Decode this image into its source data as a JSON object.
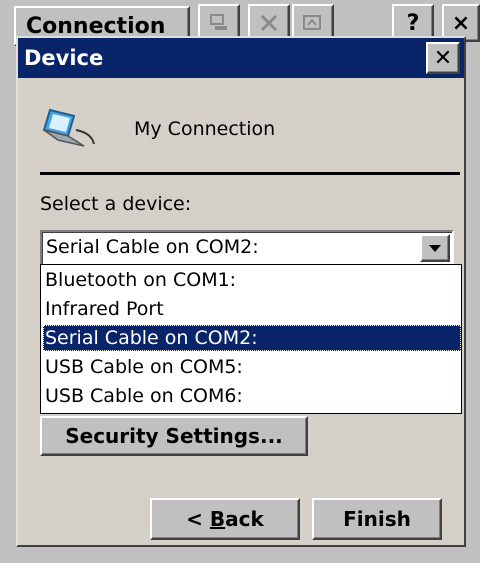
{
  "background_window": {
    "title": "Connection",
    "toolbar_icons": [
      "connect-icon",
      "delete-icon",
      "properties-icon"
    ],
    "help_label": "?",
    "close_label": "×"
  },
  "dialog": {
    "title": "Device",
    "close_label": "✕",
    "connection_icon": "network-connection-icon",
    "connection_name": "My Connection",
    "select_label": "Select a device:",
    "combo": {
      "selected_value": "Serial Cable on COM2:",
      "options": [
        "Bluetooth on COM1:",
        "Infrared Port",
        "Serial Cable on COM2:",
        "USB Cable on COM5:",
        "USB Cable on COM6:"
      ],
      "selected_index": 2
    },
    "security_button_label": "Security Settings...",
    "back_button": {
      "prefix": "< ",
      "accel": "B",
      "rest": "ack"
    },
    "finish_button_label": "Finish"
  },
  "colors": {
    "titlebar": "#0a246a",
    "selection": "#0a246a",
    "face": "#d4d0c8"
  }
}
